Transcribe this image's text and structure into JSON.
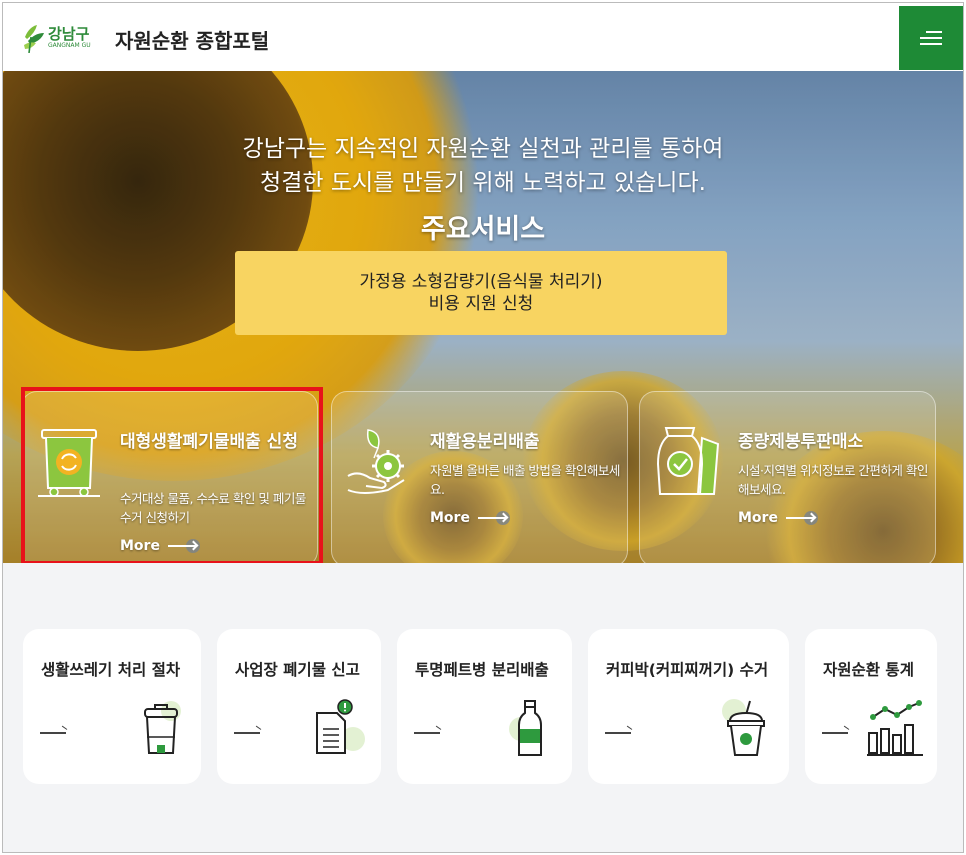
{
  "header": {
    "logo_ko": "강남구",
    "logo_en": "GANGNAM GU",
    "site_title": "자원순환 종합포털",
    "menu_icon": "hamburger-menu-icon",
    "brand_color": "#1e8a36"
  },
  "hero": {
    "line1": "강남구는 지속적인 자원순환 실천과 관리를 통하여",
    "line2": "청결한 도시를 만들기 위해 노력하고 있습니다.",
    "heading": "주요서비스",
    "cta_line1": "가정용 소형감량기(음식물 처리기)",
    "cta_line2": "비용 지원 신청",
    "cta_color": "#f8d461"
  },
  "services": [
    {
      "title": "대형생활폐기물배출 신청",
      "desc": "수거대상 물품, 수수료 확인 및 폐기물 수거 신청하기",
      "more": "More",
      "icon": "bulky-waste-bin-icon"
    },
    {
      "title": "재활용분리배출",
      "desc": "자원별 올바른 배출 방법을 확인해보세요.",
      "more": "More",
      "icon": "recycling-hand-gear-icon"
    },
    {
      "title": "종량제봉투판매소",
      "desc": "시설·지역별 위치정보로 간편하게 확인해보세요.",
      "more": "More",
      "icon": "garbage-bag-icon"
    }
  ],
  "quick_links": [
    {
      "title": "생활쓰레기 처리 절차",
      "icon": "trash-bin-icon"
    },
    {
      "title": "사업장 폐기물 신고",
      "icon": "document-alert-icon"
    },
    {
      "title": "투명페트병 분리배출",
      "icon": "pet-bottle-icon"
    },
    {
      "title": "커피박(커피찌꺼기) 수거",
      "icon": "coffee-cup-icon"
    },
    {
      "title": "자원순환 통계",
      "icon": "statistics-chart-icon"
    }
  ],
  "highlight_color": "#e8121a"
}
